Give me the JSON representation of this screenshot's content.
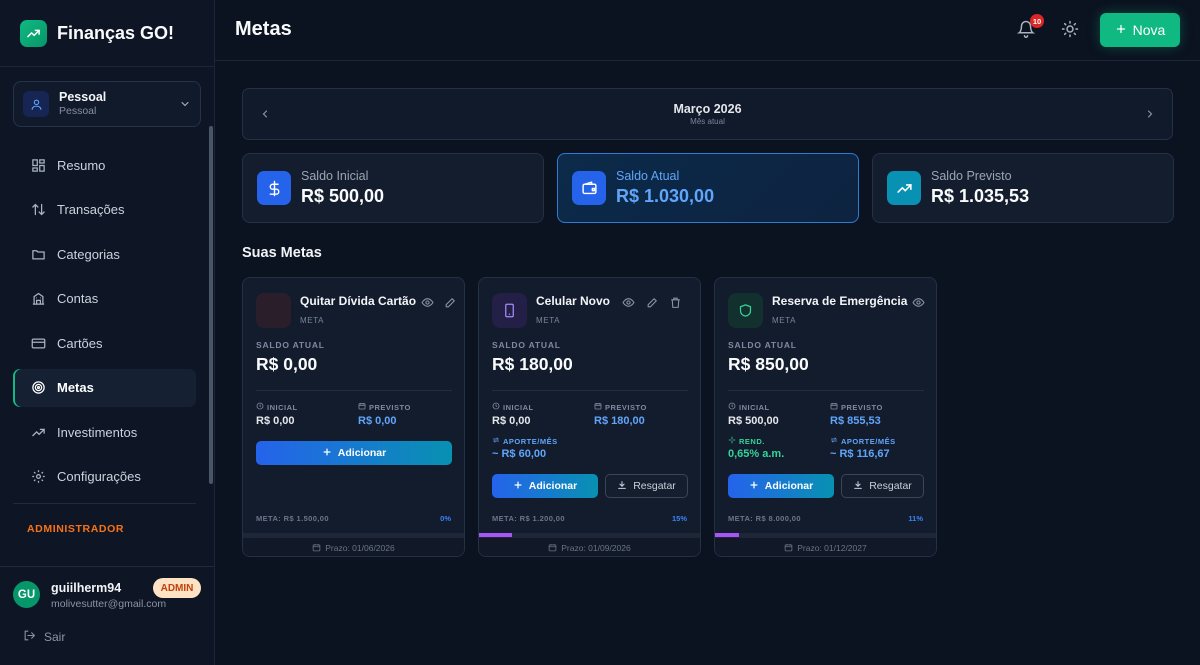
{
  "app": {
    "name": "Finanças GO!"
  },
  "profile": {
    "name": "Pessoal",
    "subtitle": "Pessoal"
  },
  "nav": [
    {
      "label": "Resumo",
      "icon": "dashboard-icon"
    },
    {
      "label": "Transações",
      "icon": "arrows-updown-icon"
    },
    {
      "label": "Categorias",
      "icon": "folder-icon"
    },
    {
      "label": "Contas",
      "icon": "building-icon"
    },
    {
      "label": "Cartões",
      "icon": "credit-card-icon"
    },
    {
      "label": "Metas",
      "icon": "target-icon",
      "active": true
    },
    {
      "label": "Investimentos",
      "icon": "trending-up-icon"
    },
    {
      "label": "Configurações",
      "icon": "gear-icon"
    }
  ],
  "admin_section": "ADMINISTRADOR",
  "user": {
    "initials": "GU",
    "name": "guiilherm94",
    "email": "molivesutter@gmail.com",
    "badge": "ADMIN",
    "logout": "Sair"
  },
  "header": {
    "title": "Metas",
    "notifications": "10",
    "new_button": "Nova"
  },
  "month": {
    "name": "Março 2026",
    "subtitle": "Mês atual"
  },
  "summary": [
    {
      "label": "Saldo Inicial",
      "value": "R$ 500,00",
      "icon": "dollar-icon",
      "color": "#2563eb"
    },
    {
      "label": "Saldo Atual",
      "value": "R$ 1.030,00",
      "icon": "wallet-icon",
      "color": "#2563eb"
    },
    {
      "label": "Saldo Previsto",
      "value": "R$ 1.035,53",
      "icon": "trending-up-icon",
      "color": "#0891b2"
    }
  ],
  "goals_title": "Suas Metas",
  "goals": [
    {
      "name": "Quitar Dívida Cartão",
      "type": "META",
      "saldo_label": "SALDO ATUAL",
      "saldo": "R$ 0,00",
      "inicial_label": "INICIAL",
      "inicial": "R$ 0,00",
      "previsto_label": "PREVISTO",
      "previsto": "R$ 0,00",
      "add": "Adicionar",
      "meta": "META: R$ 1.500,00",
      "pct": "0%",
      "progress": 0,
      "prazo": "Prazo: 01/06/2026"
    },
    {
      "name": "Celular Novo",
      "type": "META",
      "saldo_label": "SALDO ATUAL",
      "saldo": "R$ 180,00",
      "inicial_label": "INICIAL",
      "inicial": "R$ 0,00",
      "previsto_label": "PREVISTO",
      "previsto": "R$ 180,00",
      "aporte_label": "APORTE/MÊS",
      "aporte": "~ R$ 60,00",
      "add": "Adicionar",
      "resgatar": "Resgatar",
      "meta": "META: R$ 1.200,00",
      "pct": "15%",
      "progress": 0.15,
      "prazo": "Prazo: 01/09/2026"
    },
    {
      "name": "Reserva de Emergência",
      "type": "META",
      "saldo_label": "SALDO ATUAL",
      "saldo": "R$ 850,00",
      "inicial_label": "INICIAL",
      "inicial": "R$ 500,00",
      "previsto_label": "PREVISTO",
      "previsto": "R$ 855,53",
      "rend_label": "REND.",
      "rend": "0,65% a.m.",
      "aporte_label": "APORTE/MÊS",
      "aporte": "~ R$ 116,67",
      "add": "Adicionar",
      "resgatar": "Resgatar",
      "meta": "META: R$ 8.000,00",
      "pct": "11%",
      "progress": 0.11,
      "prazo": "Prazo: 01/12/2027"
    }
  ]
}
